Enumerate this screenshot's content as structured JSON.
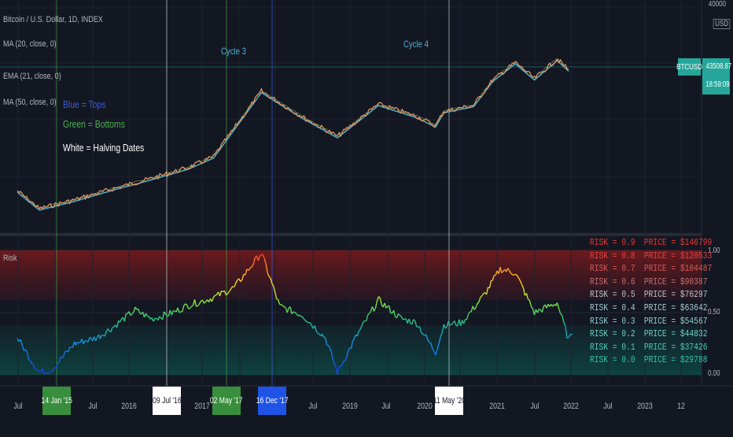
{
  "header": {
    "symbol_title": "Bitcoin / U.S. Dollar, 1D, INDEX",
    "indicators": [
      "MA (20, close, 0)",
      "EMA (21, close, 0)",
      "MA (50, close, 0)"
    ]
  },
  "notes": {
    "tops": "Blue = Tops",
    "bottoms": "Green = Bottoms",
    "halvings": "White = Halving Dates"
  },
  "cycles": [
    "Cycle 3",
    "Cycle 4"
  ],
  "price_axis": {
    "top_label": "40000",
    "unit": "USD"
  },
  "price_tag": {
    "symbol": "BTCUSD",
    "price": "43508.87",
    "countdown": "18:59:09"
  },
  "risk_panel": {
    "title": "Risk",
    "ticks": [
      "1.00",
      "0.50",
      "0.00"
    ]
  },
  "risk_table": [
    {
      "risk": "RISK = 0.9",
      "price": "PRICE = $146799"
    },
    {
      "risk": "RISK = 0.8",
      "price": "PRICE = $120533"
    },
    {
      "risk": "RISK = 0.7",
      "price": "PRICE = $104487"
    },
    {
      "risk": "RISK = 0.6",
      "price": "PRICE = $90387"
    },
    {
      "risk": "RISK = 0.5",
      "price": "PRICE = $76297"
    },
    {
      "risk": "RISK = 0.4",
      "price": "PRICE = $63642"
    },
    {
      "risk": "RISK = 0.3",
      "price": "PRICE = $54567"
    },
    {
      "risk": "RISK = 0.2",
      "price": "PRICE = $44832"
    },
    {
      "risk": "RISK = 0.1",
      "price": "PRICE = $37426"
    },
    {
      "risk": "RISK = 0.0",
      "price": "PRICE = $29788"
    }
  ],
  "time_axis": {
    "labels": [
      "Jul",
      "Jul",
      "2016",
      "2017",
      "Jul",
      "2019",
      "Jul",
      "2020",
      "2021",
      "Jul",
      "2022",
      "Jul",
      "2023",
      "12"
    ],
    "highlighted": [
      {
        "label": "14 Jan '15",
        "kind": "bottom"
      },
      {
        "label": "09 Jul '16",
        "kind": "halving"
      },
      {
        "label": "02 May '17",
        "kind": "bottom"
      },
      {
        "label": "16 Dec '17",
        "kind": "top"
      },
      {
        "label": "11 May '20",
        "kind": "halving"
      }
    ]
  },
  "colors": {
    "background": "#131722",
    "bottom_box": "#388e3c",
    "top_box": "#1e53e5",
    "halving_box": "#ffffff",
    "price_tag": "#26a69a",
    "risk_high": "#e53935",
    "risk_low": "#26a69a"
  },
  "chart_data": [
    {
      "type": "line",
      "name_hint": "price",
      "x": [
        2014.75,
        2015.04,
        2015.5,
        2016.0,
        2016.52,
        2017.0,
        2017.33,
        2017.96,
        2018.5,
        2018.96,
        2019.5,
        2020.0,
        2020.25,
        2020.36,
        2020.75,
        2021.0,
        2021.3,
        2021.55,
        2021.85,
        2022.0
      ],
      "y": [
        400,
        200,
        280,
        430,
        650,
        980,
        1500,
        19000,
        7000,
        3300,
        11500,
        7200,
        5000,
        8700,
        11000,
        29000,
        58000,
        31000,
        66000,
        43508.87
      ],
      "scale": "log"
    },
    {
      "type": "line",
      "name_hint": "risk",
      "x": [
        2014.75,
        2014.9,
        2015.04,
        2015.2,
        2015.5,
        2015.8,
        2016.0,
        2016.3,
        2016.52,
        2016.8,
        2017.0,
        2017.33,
        2017.6,
        2017.96,
        2018.2,
        2018.5,
        2018.8,
        2018.96,
        2019.2,
        2019.5,
        2019.8,
        2020.0,
        2020.25,
        2020.36,
        2020.6,
        2020.9,
        2021.1,
        2021.3,
        2021.55,
        2021.85,
        2022.0,
        2022.05
      ],
      "y": [
        0.3,
        0.15,
        0.02,
        0.04,
        0.25,
        0.3,
        0.38,
        0.52,
        0.45,
        0.5,
        0.56,
        0.62,
        0.7,
        0.98,
        0.55,
        0.48,
        0.3,
        0.02,
        0.3,
        0.6,
        0.45,
        0.42,
        0.18,
        0.4,
        0.42,
        0.65,
        0.85,
        0.82,
        0.5,
        0.58,
        0.28,
        0.32
      ],
      "ylim": [
        0,
        1
      ]
    }
  ]
}
